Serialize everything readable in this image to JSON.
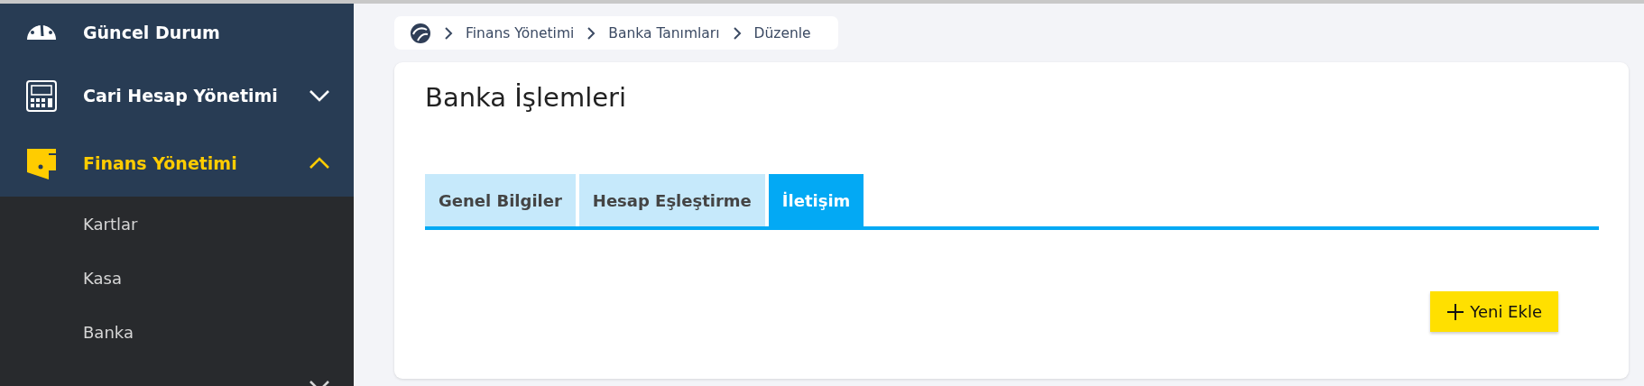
{
  "sidebar": {
    "items": [
      {
        "label": "Güncel Durum",
        "selected": false
      },
      {
        "label": "Cari Hesap Yönetimi",
        "selected": false,
        "expanded": false
      },
      {
        "label": "Finans Yönetimi",
        "selected": true,
        "expanded": true,
        "children": [
          {
            "label": "Kartlar"
          },
          {
            "label": "Kasa"
          },
          {
            "label": "Banka"
          },
          {
            "expanded": false
          }
        ]
      }
    ]
  },
  "breadcrumb": [
    "Finans Yönetimi",
    "Banka Tanımları",
    "Düzenle"
  ],
  "page": {
    "title": "Banka İşlemleri",
    "tabs": [
      {
        "label": "Genel Bilgiler",
        "selected": false
      },
      {
        "label": "Hesap Eşleştirme",
        "selected": false
      },
      {
        "label": "İletişim",
        "selected": true
      }
    ],
    "add_button": "Yeni Ekle"
  }
}
